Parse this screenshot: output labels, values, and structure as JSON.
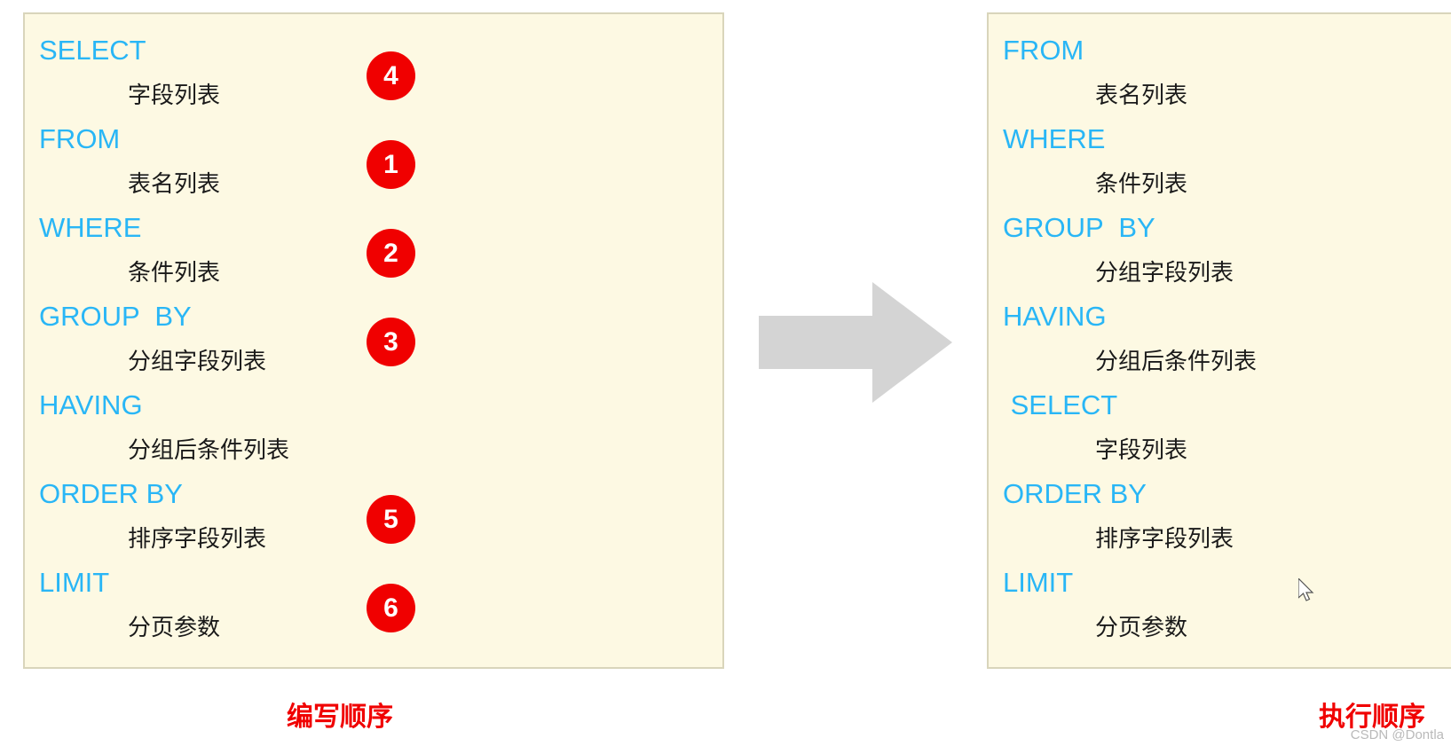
{
  "left_panel": {
    "caption": "编写顺序",
    "clauses": [
      {
        "keyword": "SELECT",
        "value": "字段列表",
        "badge": "4"
      },
      {
        "keyword": "FROM",
        "value": "表名列表",
        "badge": "1"
      },
      {
        "keyword": "WHERE",
        "value": "条件列表",
        "badge": "2"
      },
      {
        "keyword": "GROUP  BY",
        "value": "分组字段列表",
        "badge": "3"
      },
      {
        "keyword": "HAVING",
        "value": "分组后条件列表",
        "badge": ""
      },
      {
        "keyword": "ORDER BY",
        "value": "排序字段列表",
        "badge": "5"
      },
      {
        "keyword": "LIMIT",
        "value": "分页参数",
        "badge": "6"
      }
    ]
  },
  "right_panel": {
    "caption": "执行顺序",
    "clauses": [
      {
        "keyword": "FROM",
        "value": "表名列表"
      },
      {
        "keyword": "WHERE",
        "value": "条件列表"
      },
      {
        "keyword": "GROUP  BY",
        "value": "分组字段列表"
      },
      {
        "keyword": "HAVING",
        "value": "分组后条件列表"
      },
      {
        "keyword": " SELECT",
        "value": "字段列表"
      },
      {
        "keyword": "ORDER BY",
        "value": "排序字段列表"
      },
      {
        "keyword": "LIMIT",
        "value": "分页参数"
      }
    ]
  },
  "arrow": {
    "name": "right-arrow",
    "color": "#d4d4d4"
  },
  "watermark": "CSDN @Dontla",
  "colors": {
    "keyword": "#29b6f6",
    "badge": "#f00000",
    "panel_bg": "#fdf9e3",
    "panel_border": "#d9d5bb",
    "caption": "#f00000"
  }
}
